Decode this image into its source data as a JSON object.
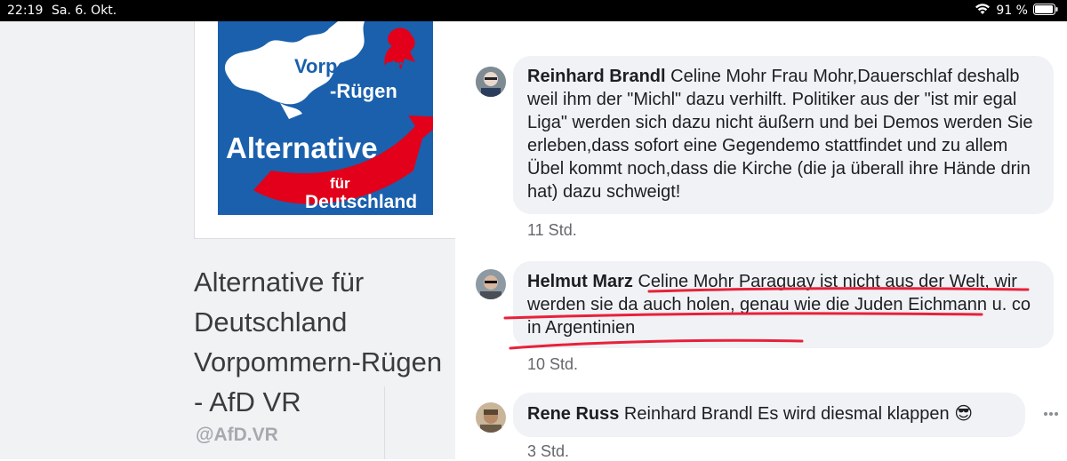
{
  "statusbar": {
    "time": "22:19",
    "date": "Sa. 6. Okt.",
    "battery": "91 %"
  },
  "page": {
    "logo": {
      "region": "Vorpommern",
      "region2": "-Rügen",
      "party": "Alternative",
      "fur": "für",
      "country": "Deutschland",
      "accent": "#e2001a",
      "brand": "#1a60ad"
    },
    "name_lines": [
      "Alternative für",
      "Deutschland",
      "Vorpommern-Rügen",
      "- AfD VR"
    ],
    "handle": "@AfD.VR"
  },
  "comments": [
    {
      "author": "Reinhard Brandl",
      "text": " Celine Mohr Frau Mohr,Dauerschlaf deshalb weil ihm der \"Michl\" dazu verhilft. Politiker aus der \"ist mir egal Liga\" werden sich dazu nicht äußern und bei Demos werden Sie erleben,dass sofort eine Gegendemo stattfindet und zu allem Übel kommt noch,dass die Kirche (die ja überall ihre Hände drin hat) dazu schweigt!",
      "time": "11 Std."
    },
    {
      "author": "Helmut Marz",
      "text": " Celine Mohr Paraguay ist nicht aus der Welt, wir werden sie da auch holen, genau wie die Juden Eichmann u. co in Argentinien",
      "time": "10 Std."
    },
    {
      "author": "Rene Russ",
      "text": " Reinhard Brandl Es wird diesmal klappen",
      "emoji": "😎",
      "time": "3 Std."
    }
  ],
  "colors": {
    "annotation_underline": "#e8213a",
    "bubble_bg": "#f0f2f5",
    "timestamp": "#65676b"
  }
}
